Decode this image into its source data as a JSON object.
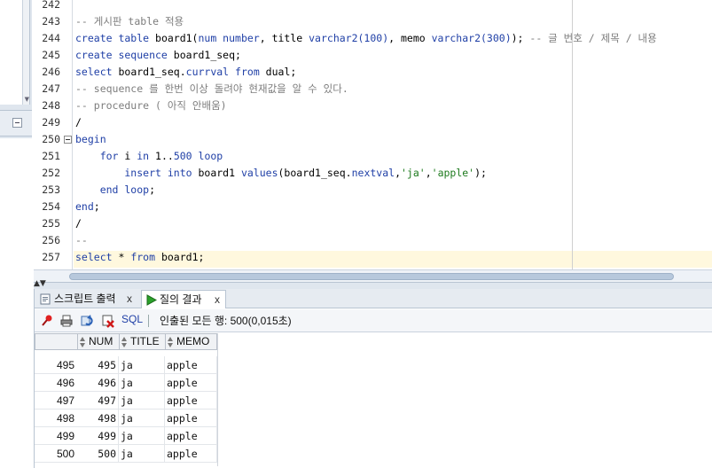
{
  "editor": {
    "lines": [
      {
        "n": "242",
        "parts": []
      },
      {
        "n": "243",
        "parts": [
          {
            "t": "-- 게시판 table 적용",
            "c": "cm"
          }
        ]
      },
      {
        "n": "244",
        "parts": [
          {
            "t": "create table",
            "c": "kw"
          },
          {
            "t": " board1(",
            "c": ""
          },
          {
            "t": "num number",
            "c": "kw"
          },
          {
            "t": ", title ",
            "c": ""
          },
          {
            "t": "varchar2(100)",
            "c": "kw"
          },
          {
            "t": ", memo ",
            "c": ""
          },
          {
            "t": "varchar2(300)",
            "c": "kw"
          },
          {
            "t": "); ",
            "c": ""
          },
          {
            "t": "-- 글 번호 / 제목 / 내용",
            "c": "cm"
          }
        ]
      },
      {
        "n": "245",
        "parts": [
          {
            "t": "create sequence",
            "c": "kw"
          },
          {
            "t": " board1_seq;",
            "c": ""
          }
        ]
      },
      {
        "n": "246",
        "parts": [
          {
            "t": "select",
            "c": "kw"
          },
          {
            "t": " board1_seq.",
            "c": ""
          },
          {
            "t": "currval",
            "c": "kw"
          },
          {
            "t": " ",
            "c": ""
          },
          {
            "t": "from",
            "c": "kw"
          },
          {
            "t": " dual;",
            "c": ""
          }
        ]
      },
      {
        "n": "247",
        "parts": [
          {
            "t": "-- sequence 를 한번 이상 돌려야 현재값을 알 수 있다.",
            "c": "cm"
          }
        ]
      },
      {
        "n": "248",
        "parts": [
          {
            "t": "-- procedure ( 아직 안배움)",
            "c": "cm"
          }
        ]
      },
      {
        "n": "249",
        "parts": [
          {
            "t": "/",
            "c": ""
          }
        ]
      },
      {
        "n": "250",
        "parts": [
          {
            "t": "begin",
            "c": "kw"
          }
        ],
        "fold": true
      },
      {
        "n": "251",
        "parts": [
          {
            "t": "    for",
            "c": "kw"
          },
          {
            "t": " i ",
            "c": ""
          },
          {
            "t": "in",
            "c": "kw"
          },
          {
            "t": " 1..",
            "c": ""
          },
          {
            "t": "500",
            "c": "num"
          },
          {
            "t": " ",
            "c": ""
          },
          {
            "t": "loop",
            "c": "kw"
          }
        ]
      },
      {
        "n": "252",
        "parts": [
          {
            "t": "        insert into",
            "c": "kw"
          },
          {
            "t": " board1 ",
            "c": ""
          },
          {
            "t": "values",
            "c": "kw"
          },
          {
            "t": "(board1_seq.",
            "c": ""
          },
          {
            "t": "nextval",
            "c": "kw"
          },
          {
            "t": ",",
            "c": ""
          },
          {
            "t": "'ja'",
            "c": "str"
          },
          {
            "t": ",",
            "c": ""
          },
          {
            "t": "'apple'",
            "c": "str"
          },
          {
            "t": ");",
            "c": ""
          }
        ]
      },
      {
        "n": "253",
        "parts": [
          {
            "t": "    end loop",
            "c": "kw"
          },
          {
            "t": ";",
            "c": ""
          }
        ]
      },
      {
        "n": "254",
        "parts": [
          {
            "t": "end",
            "c": "kw"
          },
          {
            "t": ";",
            "c": ""
          }
        ]
      },
      {
        "n": "255",
        "parts": [
          {
            "t": "/",
            "c": ""
          }
        ]
      },
      {
        "n": "256",
        "parts": [
          {
            "t": "--",
            "c": "cm"
          }
        ]
      },
      {
        "n": "257",
        "parts": [
          {
            "t": "select",
            "c": "kw"
          },
          {
            "t": " * ",
            "c": ""
          },
          {
            "t": "from",
            "c": "kw"
          },
          {
            "t": " board1;",
            "c": ""
          }
        ],
        "current": true
      }
    ]
  },
  "tabs": {
    "script_output": "스크립트 출력",
    "query_result": "질의 결과",
    "close": "x"
  },
  "toolbar": {
    "sql_label": "SQL",
    "fetch_status": "인출된 모든 행: 500(0,015초)"
  },
  "grid": {
    "columns": [
      "NUM",
      "TITLE",
      "MEMO"
    ],
    "rows": [
      {
        "rownum": "495",
        "num": "495",
        "title": "ja",
        "memo": "apple"
      },
      {
        "rownum": "496",
        "num": "496",
        "title": "ja",
        "memo": "apple"
      },
      {
        "rownum": "497",
        "num": "497",
        "title": "ja",
        "memo": "apple"
      },
      {
        "rownum": "498",
        "num": "498",
        "title": "ja",
        "memo": "apple"
      },
      {
        "rownum": "499",
        "num": "499",
        "title": "ja",
        "memo": "apple"
      },
      {
        "rownum": "500",
        "num": "500",
        "title": "ja",
        "memo": "apple"
      }
    ]
  },
  "colors": {
    "keyword": "#1f3fa6",
    "comment": "#7d7d7d",
    "string": "#1d7a1d",
    "current_line": "#fff8de"
  },
  "icons": {
    "toolbar": [
      "pin-icon",
      "print-icon",
      "refresh-icon",
      "delete-icon"
    ],
    "tabs": [
      "script-output-icon",
      "run-query-icon"
    ]
  }
}
